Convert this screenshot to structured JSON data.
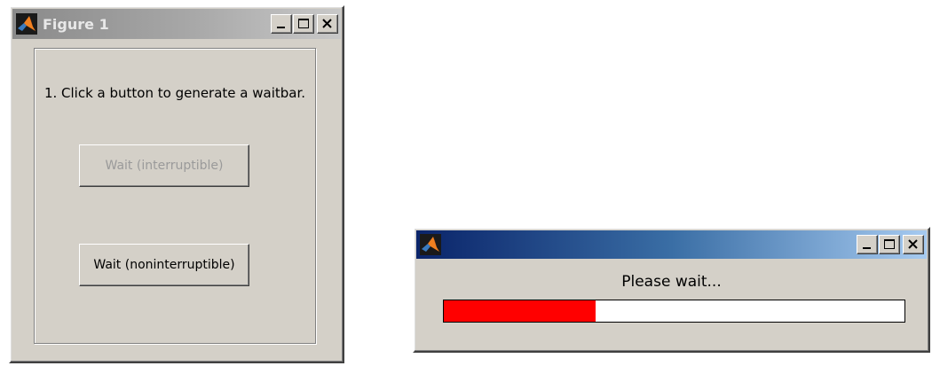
{
  "figure_window": {
    "title": "Figure 1",
    "instruction": "1. Click a button to generate a waitbar.",
    "buttons": {
      "interruptible": {
        "label": "Wait (interruptible)",
        "enabled": false
      },
      "noninterruptible": {
        "label": "Wait (noninterruptible)",
        "enabled": true
      }
    }
  },
  "waitbar_window": {
    "title": "",
    "message": "Please wait...",
    "progress": 0.33,
    "fill_color": "#ff0000"
  },
  "icons": {
    "app_logo": "matlab-logo-icon",
    "minimize": "minimize-icon",
    "maximize": "maximize-icon",
    "close": "close-icon"
  }
}
